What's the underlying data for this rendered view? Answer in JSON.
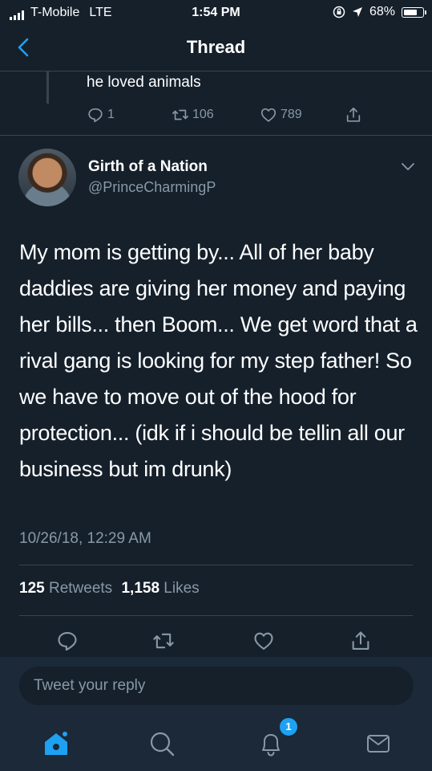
{
  "status": {
    "carrier": "T-Mobile",
    "network": "LTE",
    "time": "1:54 PM",
    "battery": "68%"
  },
  "nav": {
    "title": "Thread",
    "back_icon": "chevron-left-icon"
  },
  "previous_tweet": {
    "text": "he loved animals",
    "replies": "1",
    "retweets": "106",
    "likes": "789"
  },
  "tweet": {
    "author_name": "Girth of a Nation",
    "author_handle": "@PrinceCharmingP",
    "text": "My mom is getting by... All of her baby daddies are giving her money and paying her bills... then Boom... We get word that a rival gang is looking for my step father! So we have to move out of the hood for protection... (idk if i should be tellin all our business but im drunk)",
    "timestamp": "10/26/18, 12:29 AM",
    "retweet_count": "125",
    "retweet_label": "Retweets",
    "like_count": "1,158",
    "like_label": "Likes"
  },
  "reply": {
    "placeholder": "Tweet your reply"
  },
  "tabbar": {
    "notifications_badge": "1"
  },
  "colors": {
    "background": "#15202b",
    "accent": "#1da1f2",
    "muted": "#8899a6",
    "divider": "#38444d"
  }
}
